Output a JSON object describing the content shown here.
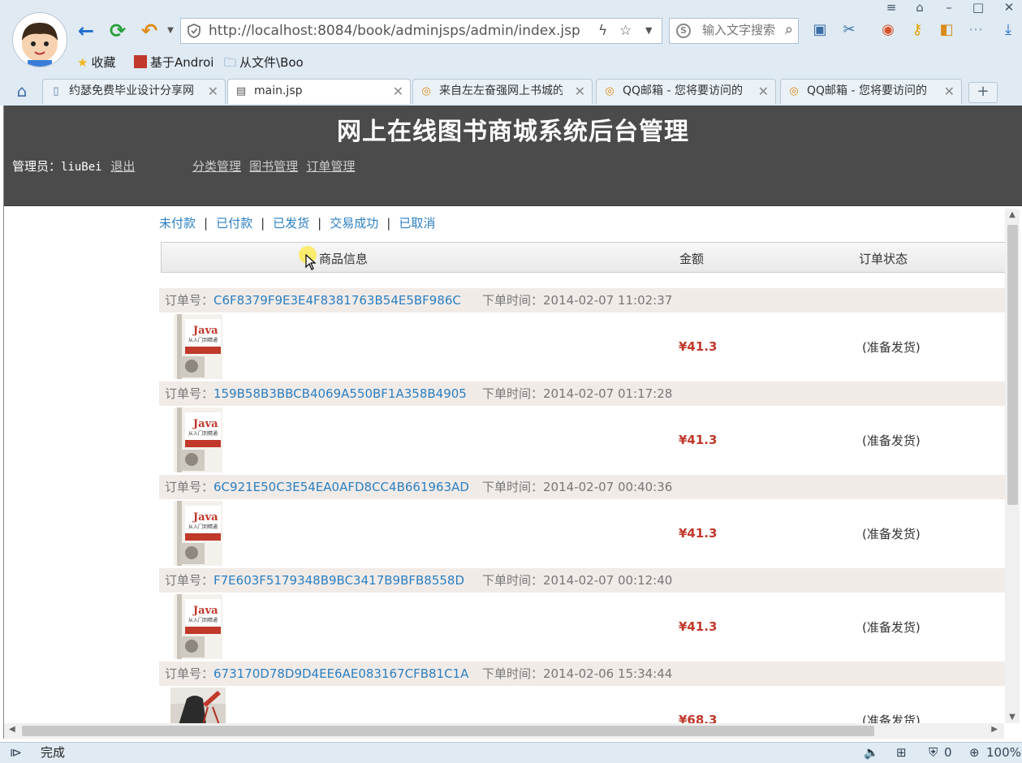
{
  "browser": {
    "url_host": "http://localhost:8084",
    "url_path": "/book/adminjsps/admin/index.jsp",
    "search_placeholder": "输入文字搜索",
    "bookmarks": [
      {
        "label": "收藏",
        "icon": "star-icon"
      },
      {
        "label": "基于Androi",
        "icon": "site-icon"
      },
      {
        "label": "从文件\\Boo",
        "icon": "folder-icon"
      }
    ],
    "tabs": [
      {
        "label": "约瑟免费毕业设计分享网",
        "active": false
      },
      {
        "label": "main.jsp",
        "active": true
      },
      {
        "label": "来自左左奋强网上书城的",
        "active": false
      },
      {
        "label": "QQ邮箱 - 您将要访问的",
        "active": false
      },
      {
        "label": "QQ邮箱 - 您将要访问的",
        "active": false
      }
    ],
    "new_tab_label": "+",
    "status_text": "完成",
    "status_zero": "0",
    "zoom": "100%"
  },
  "header": {
    "title": "网上在线图书商城系统后台管理",
    "admin_label": "管理员：",
    "admin_name": "liuBei",
    "logout": "退出",
    "menu": [
      "分类管理",
      "图书管理",
      "订单管理"
    ]
  },
  "filters": [
    "未付款",
    "已付款",
    "已发货",
    "交易成功",
    "已取消"
  ],
  "filter_sep": "|",
  "table_headers": {
    "product": "商品信息",
    "amount": "金额",
    "status": "订单状态"
  },
  "order_labels": {
    "number": "订单号：",
    "time": "下单时间："
  },
  "orders": [
    {
      "id": "C6F8379F9E3E4F8381763B54E5BF986C",
      "time": "2014-02-07 11:02:37",
      "price": "¥41.3",
      "status": "(准备发货)",
      "book": "java"
    },
    {
      "id": "159B58B3BBCB4069A550BF1A358B4905",
      "time": "2014-02-07 01:17:28",
      "price": "¥41.3",
      "status": "(准备发货)",
      "book": "java"
    },
    {
      "id": "6C921E50C3E54EA0AFD8CC4B661963AD",
      "time": "2014-02-07 00:40:36",
      "price": "¥41.3",
      "status": "(准备发货)",
      "book": "java"
    },
    {
      "id": "F7E603F5179348B9BC3417B9BFB8558D",
      "time": "2014-02-07 00:12:40",
      "price": "¥41.3",
      "status": "(准备发货)",
      "book": "java"
    },
    {
      "id": "673170D78D9D4EE6AE083167CFB81C1A",
      "time": "2014-02-06 15:34:44",
      "price": "¥68.3",
      "status": "(准备发货)",
      "book": "photo"
    }
  ],
  "book_cover_text": {
    "title": "Java",
    "subtitle": "从入门到精通"
  }
}
